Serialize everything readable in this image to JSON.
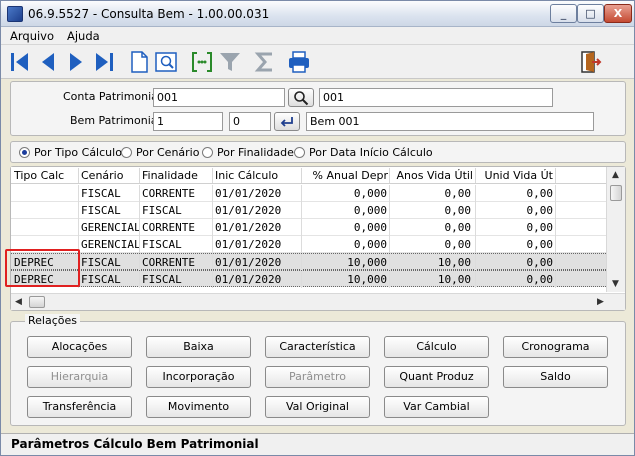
{
  "window": {
    "title": "06.9.5527 - Consulta Bem - 1.00.00.031",
    "minimize": "_",
    "maximize": "□",
    "close": "X"
  },
  "menu": [
    "Arquivo",
    "Ajuda"
  ],
  "toolbar": [
    "first-icon",
    "previous-icon",
    "next-icon",
    "last-icon",
    "new-document-icon",
    "preview-icon",
    "goto-icon",
    "filter-icon",
    "sum-icon",
    "print-icon",
    "exit-icon"
  ],
  "form": {
    "conta_label": "Conta Patrimonial:",
    "conta_value": "001",
    "conta_desc": "001",
    "bem_label": "Bem Patrimonial:",
    "bem_value": "1",
    "bem_seq": "0",
    "bem_desc": "Bem 001"
  },
  "radios": [
    {
      "label": "Por Tipo Cálculo",
      "selected": true
    },
    {
      "label": "Por Cenário",
      "selected": false
    },
    {
      "label": "Por Finalidade",
      "selected": false
    },
    {
      "label": "Por Data Início Cálculo",
      "selected": false
    }
  ],
  "table": {
    "headers": [
      "Tipo Calc",
      "Cenário",
      "Finalidade",
      "Inic Cálculo",
      "% Anual Depr",
      "Anos Vida Útil",
      "Unid Vida Út"
    ],
    "rows": [
      [
        "",
        "FISCAL",
        "CORRENTE",
        "01/01/2020",
        "0,000",
        "0,00",
        "0,00"
      ],
      [
        "",
        "FISCAL",
        "FISCAL",
        "01/01/2020",
        "0,000",
        "0,00",
        "0,00"
      ],
      [
        "",
        "GERENCIAL",
        "CORRENTE",
        "01/01/2020",
        "0,000",
        "0,00",
        "0,00"
      ],
      [
        "",
        "GERENCIAL",
        "FISCAL",
        "01/01/2020",
        "0,000",
        "0,00",
        "0,00"
      ],
      [
        "DEPREC",
        "FISCAL",
        "CORRENTE",
        "01/01/2020",
        "10,000",
        "10,00",
        "0,00"
      ],
      [
        "DEPREC",
        "FISCAL",
        "FISCAL",
        "01/01/2020",
        "10,000",
        "10,00",
        "0,00"
      ]
    ]
  },
  "relacoes": {
    "title": "Relações",
    "buttons": [
      {
        "label": "Alocações",
        "enabled": true
      },
      {
        "label": "Baixa",
        "enabled": true
      },
      {
        "label": "Característica",
        "enabled": true
      },
      {
        "label": "Cálculo",
        "enabled": true
      },
      {
        "label": "Cronograma",
        "enabled": true
      },
      {
        "label": "Hierarquia",
        "enabled": false
      },
      {
        "label": "Incorporação",
        "enabled": true
      },
      {
        "label": "Parâmetro",
        "enabled": false
      },
      {
        "label": "Quant Produz",
        "enabled": true
      },
      {
        "label": "Saldo",
        "enabled": true
      },
      {
        "label": "Transferência",
        "enabled": true
      },
      {
        "label": "Movimento",
        "enabled": true
      },
      {
        "label": "Val Original",
        "enabled": true
      },
      {
        "label": "Var Cambial",
        "enabled": true
      }
    ]
  },
  "status": "Parâmetros Cálculo Bem Patrimonial",
  "colors": {
    "highlight_box": "#e02020",
    "toolbar_blue": "#1f5fbf"
  }
}
